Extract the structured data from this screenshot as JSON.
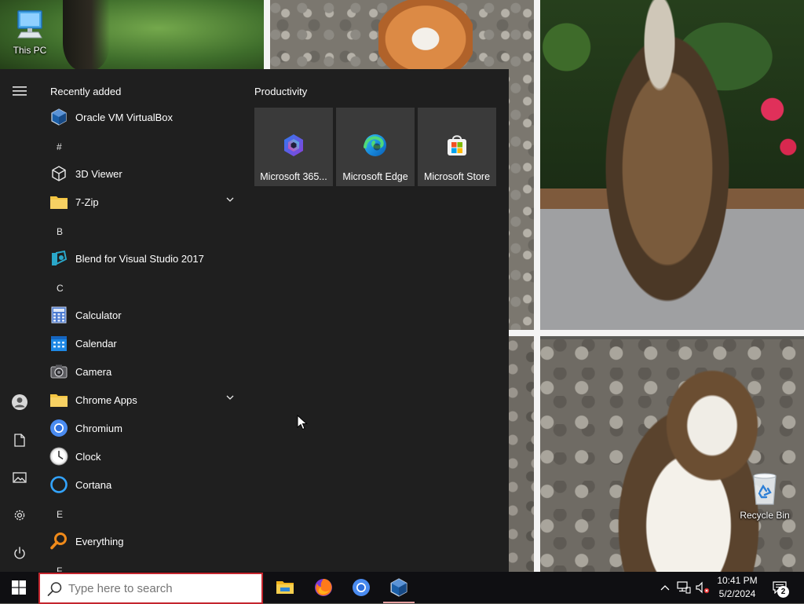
{
  "desktop": {
    "icons": [
      {
        "label": "This PC",
        "icon": "computer-icon"
      },
      {
        "label": "Recycle Bin",
        "icon": "recycle-bin-icon"
      }
    ]
  },
  "start_menu": {
    "rail": [
      "hamburger-menu-icon",
      "user-account-icon",
      "documents-icon",
      "pictures-icon",
      "settings-gear-icon",
      "power-icon"
    ],
    "recently_added_title": "Recently added",
    "recent_items": [
      {
        "label": "Oracle VM VirtualBox",
        "icon": "virtualbox-icon"
      }
    ],
    "groups": [
      {
        "letter": "#",
        "items": [
          {
            "label": "3D Viewer",
            "icon": "3d-cube-icon"
          },
          {
            "label": "7-Zip",
            "icon": "folder-icon",
            "expandable": true
          }
        ]
      },
      {
        "letter": "B",
        "items": [
          {
            "label": "Blend for Visual Studio 2017",
            "icon": "blend-icon"
          }
        ]
      },
      {
        "letter": "C",
        "items": [
          {
            "label": "Calculator",
            "icon": "calculator-icon"
          },
          {
            "label": "Calendar",
            "icon": "calendar-icon"
          },
          {
            "label": "Camera",
            "icon": "camera-icon"
          },
          {
            "label": "Chrome Apps",
            "icon": "folder-icon",
            "expandable": true
          },
          {
            "label": "Chromium",
            "icon": "chromium-icon"
          },
          {
            "label": "Clock",
            "icon": "clock-icon"
          },
          {
            "label": "Cortana",
            "icon": "cortana-icon"
          }
        ]
      },
      {
        "letter": "E",
        "items": [
          {
            "label": "Everything",
            "icon": "search-magnifier-icon"
          }
        ]
      },
      {
        "letter": "F",
        "items": []
      }
    ],
    "tiles_group_title": "Productivity",
    "tiles": [
      {
        "label": "Microsoft 365...",
        "icon": "microsoft-365-icon"
      },
      {
        "label": "Microsoft Edge",
        "icon": "edge-icon"
      },
      {
        "label": "Microsoft Store",
        "icon": "store-icon"
      }
    ]
  },
  "taskbar": {
    "search_placeholder": "Type here to search",
    "pinned": [
      "file-explorer-icon",
      "firefox-icon",
      "chromium-icon",
      "virtualbox-icon"
    ],
    "tray_icons": [
      "chevron-up-icon",
      "network-icon",
      "volume-muted-icon"
    ],
    "time": "10:41 PM",
    "date": "5/2/2024",
    "notification_count": "2"
  },
  "colors": {
    "start_menu_bg": "#1f1f1f",
    "tile_bg": "#3a3a3a",
    "taskbar_bg": "#0f0f12",
    "search_border": "#c4262e",
    "folder_yellow": "#f4c542"
  }
}
